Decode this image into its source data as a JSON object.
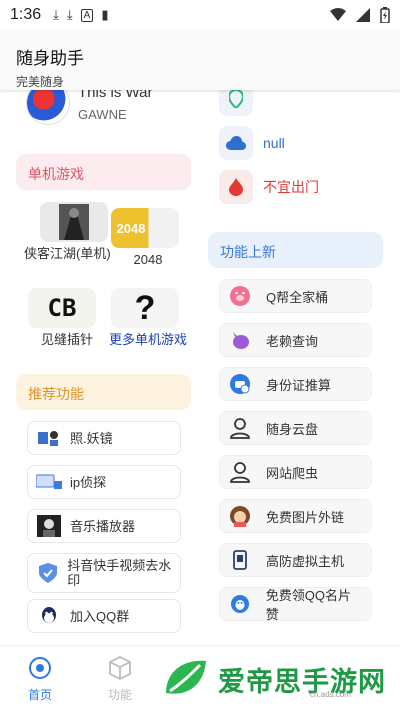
{
  "status_bar": {
    "time": "1:36",
    "icons": [
      "download-icon",
      "download-icon",
      "a-icon",
      "book-icon",
      "wifi-icon",
      "signal-icon",
      "battery-icon"
    ]
  },
  "header": {
    "title": "随身助手",
    "subtitle": "完美随身"
  },
  "profile": {
    "name": "This is War",
    "username": "GAWNE"
  },
  "weather": [
    {
      "icon": "location-icon",
      "label": "",
      "color": "#2bb673"
    },
    {
      "icon": "cloud-icon",
      "label": "null",
      "color": "#2f6fd0"
    },
    {
      "icon": "fire-icon",
      "label": "不宜出门",
      "color": "#e53935"
    }
  ],
  "games_section": {
    "title": "单机游戏",
    "items": [
      {
        "label": "侠客江湖(单机)",
        "icon": "game-thumb-icon"
      },
      {
        "label": "2048",
        "icon_text": "2048"
      },
      {
        "label": "见缝插针",
        "icon_text": "CB"
      },
      {
        "label": "更多单机游戏",
        "icon_text": "?"
      }
    ]
  },
  "recommend_section": {
    "title": "推荐功能",
    "items": [
      {
        "label": "照.妖镜",
        "icon": "mirror-icon"
      },
      {
        "label": "ip侦探",
        "icon": "ip-icon"
      },
      {
        "label": "音乐播放器",
        "icon": "music-icon"
      },
      {
        "label": "抖音快手视频去水印",
        "icon": "shield-icon"
      },
      {
        "label": "加入QQ群",
        "icon": "qq-icon"
      }
    ]
  },
  "function_section": {
    "title": "功能上新",
    "items": [
      {
        "label": "Q帮全家桶",
        "icon": "pig-icon"
      },
      {
        "label": "老赖查询",
        "icon": "eggplant-icon"
      },
      {
        "label": "身份证推算",
        "icon": "id-chat-icon"
      },
      {
        "label": "随身云盘",
        "icon": "user-icon"
      },
      {
        "label": "网站爬虫",
        "icon": "user-icon"
      },
      {
        "label": "免费图片外链",
        "icon": "girl-avatar-icon"
      },
      {
        "label": "高防虚拟主机",
        "icon": "phone-icon"
      },
      {
        "label": "免费领QQ名片赞",
        "icon": "qq-circle-icon"
      }
    ]
  },
  "bottom_nav": {
    "items": [
      {
        "label": "首页",
        "icon": "home-target-icon",
        "active": true
      },
      {
        "label": "功能",
        "icon": "cube-icon",
        "active": false
      }
    ]
  },
  "watermark": {
    "text": "爱帝思手游网",
    "subtext": "cn.ads.com"
  },
  "colors": {
    "accent_blue": "#2a7be4",
    "games_header_bg": "#fdecef",
    "games_header_text": "#e25563",
    "recommend_header_bg": "#fdf3df",
    "recommend_header_text": "#e0922c",
    "function_header_bg": "#e8f0fb",
    "function_header_text": "#3a7ad1",
    "watermark_green": "#1e9a45"
  }
}
